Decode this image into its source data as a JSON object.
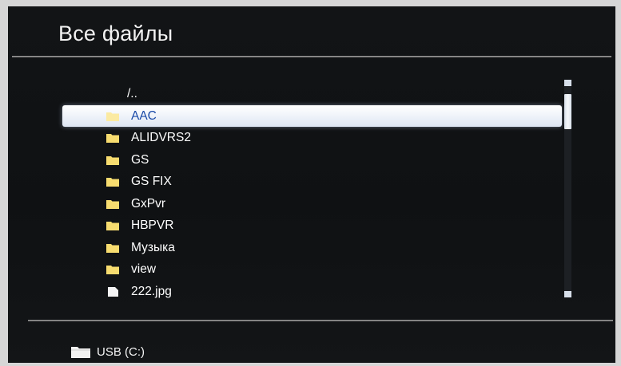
{
  "screen": {
    "title": "Все файлы"
  },
  "file_list": {
    "items": [
      {
        "name": "/..",
        "type": "parent",
        "selected": false
      },
      {
        "name": "AAC",
        "type": "folder",
        "selected": true
      },
      {
        "name": "ALIDVRS2",
        "type": "folder",
        "selected": false
      },
      {
        "name": "GS",
        "type": "folder",
        "selected": false
      },
      {
        "name": "GS FIX",
        "type": "folder",
        "selected": false
      },
      {
        "name": "GxPvr",
        "type": "folder",
        "selected": false
      },
      {
        "name": "HBPVR",
        "type": "folder",
        "selected": false
      },
      {
        "name": "Музыка",
        "type": "folder",
        "selected": false
      },
      {
        "name": "view",
        "type": "folder",
        "selected": false
      },
      {
        "name": "222.jpg",
        "type": "file",
        "selected": false
      }
    ]
  },
  "footer": {
    "device_label": "USB (C:)",
    "device_icon": "folder-icon"
  },
  "colors": {
    "background": "#121416",
    "text": "#ffffff",
    "selection_text": "#1a4aa8",
    "folder_icon": "#f7dc6f"
  }
}
